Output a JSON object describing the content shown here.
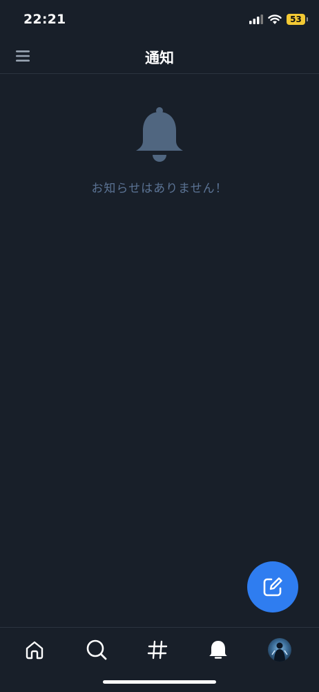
{
  "status_bar": {
    "time": "22:21",
    "battery": "53"
  },
  "header": {
    "title": "通知"
  },
  "empty_state": {
    "message": "お知らせはありません！"
  },
  "tabs": [
    {
      "name": "home",
      "icon": "home-icon"
    },
    {
      "name": "search",
      "icon": "search-icon"
    },
    {
      "name": "hashtag",
      "icon": "hashtag-icon"
    },
    {
      "name": "notifications",
      "icon": "bell-icon",
      "active": true
    },
    {
      "name": "profile",
      "icon": "avatar"
    }
  ],
  "colors": {
    "background": "#181f29",
    "accent": "#2f7df0",
    "muted": "#5b7394",
    "battery": "#f3c934"
  }
}
